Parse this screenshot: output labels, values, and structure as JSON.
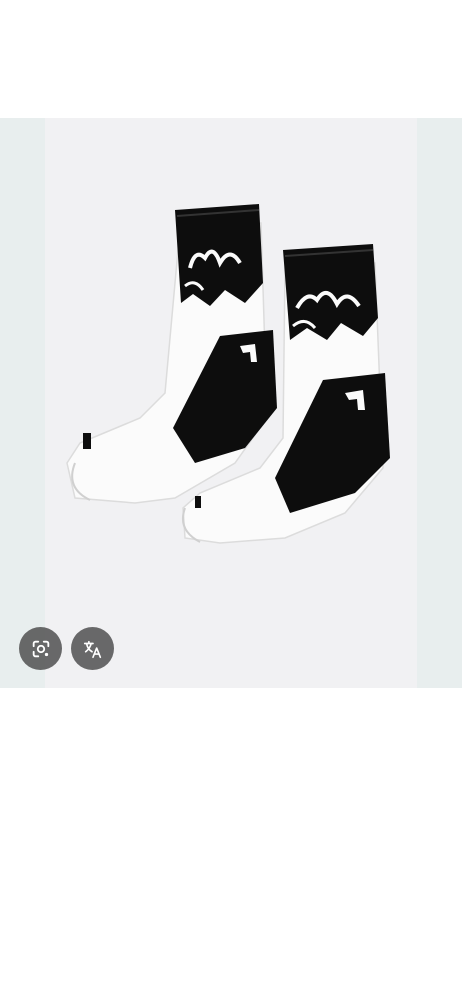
{
  "image": {
    "subject": "sock-pair-product-photo"
  },
  "overlay": {
    "lens_icon": "google-lens-icon",
    "translate_icon": "translate-icon"
  },
  "colors": {
    "frame_bg": "#e8eeee",
    "photo_bg": "#f1f1f3",
    "sock_black": "#0d0d0d",
    "sock_white": "#fbfbfb",
    "button_bg": "#505050"
  }
}
